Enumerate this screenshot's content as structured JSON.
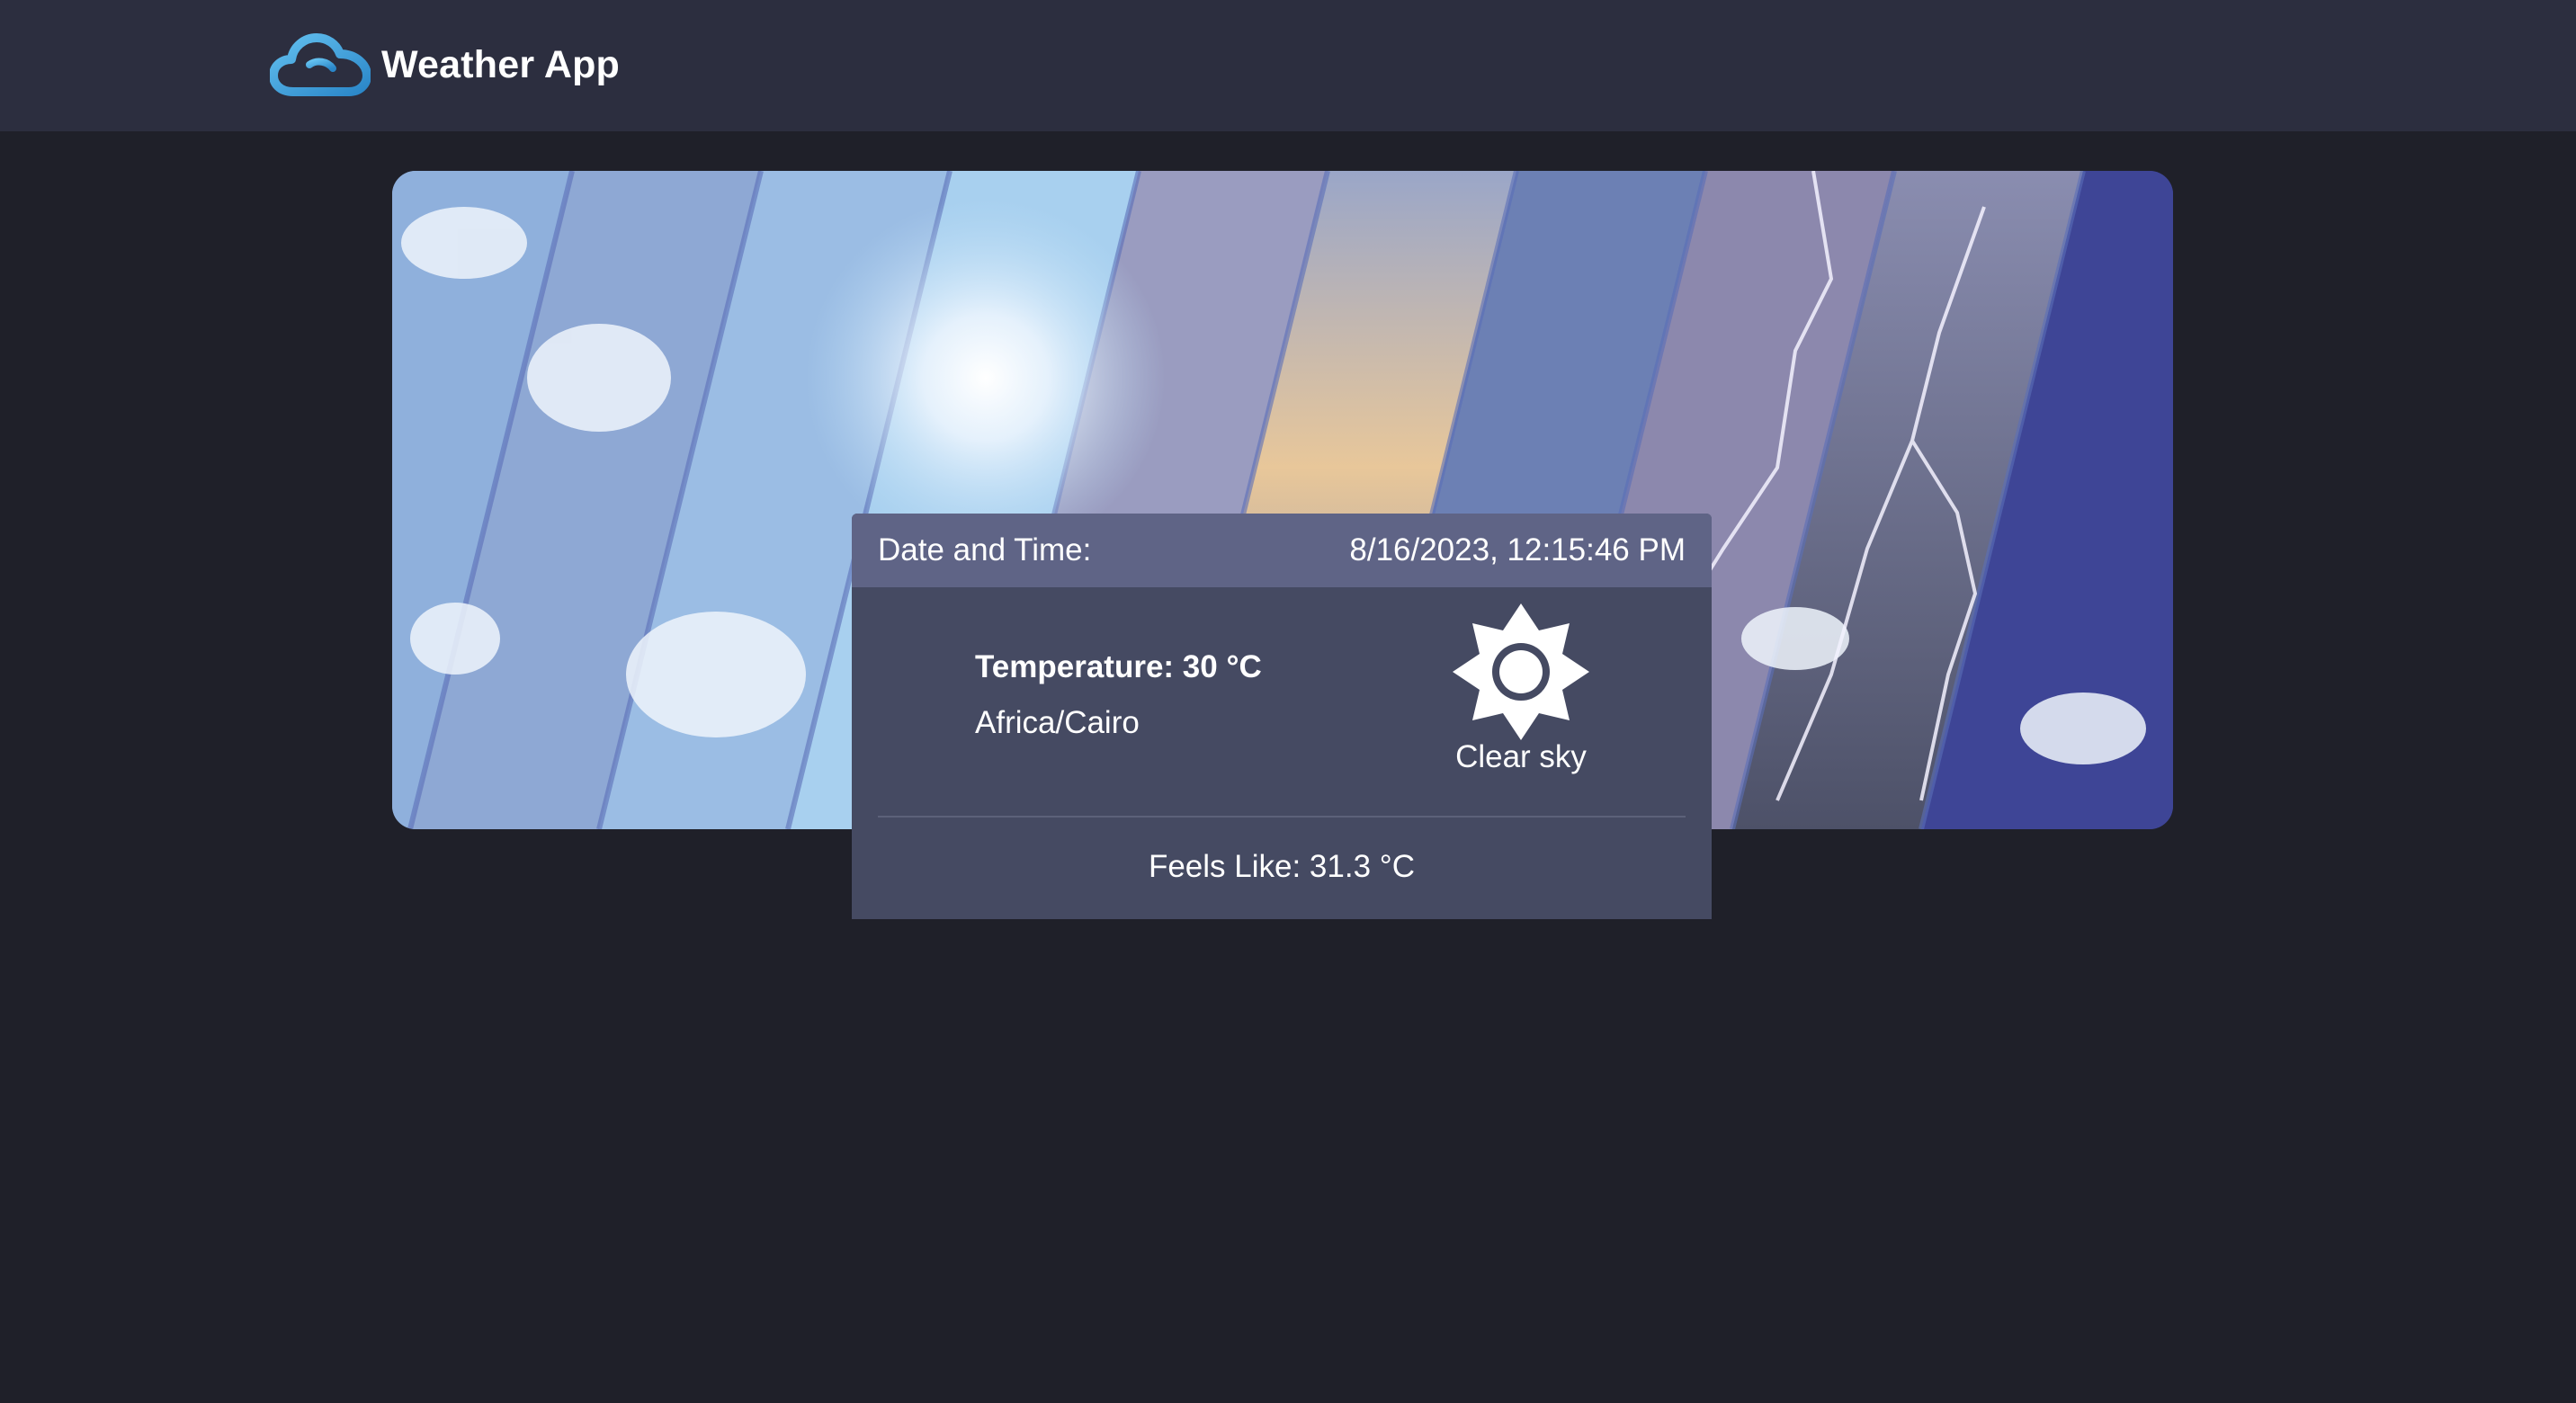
{
  "navbar": {
    "brand_icon": "cloud-icon",
    "brand_title": "Weather App",
    "brand_color": "#3aa0d8"
  },
  "hero": {
    "image": "weather-collage-banner"
  },
  "weather_card": {
    "header_label": "Date and Time:",
    "header_value": "8/16/2023, 12:15:46 PM",
    "temperature": "Temperature: 30 °C",
    "timezone": "Africa/Cairo",
    "condition_icon": "sun-icon",
    "condition": "Clear sky",
    "feels_like": "Feels Like: 31.3 °C"
  },
  "colors": {
    "page_bg": "#1f2029",
    "navbar_bg": "#2c2e3f",
    "card_bg": "#454a62",
    "card_header_bg": "#5f6486"
  }
}
